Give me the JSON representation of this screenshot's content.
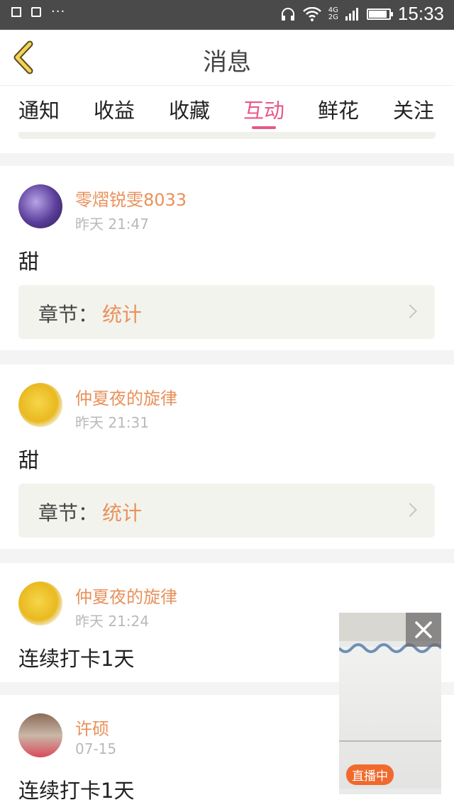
{
  "status_bar": {
    "time": "15:33",
    "network_top": "4G",
    "network_bottom": "2G",
    "battery_level": 0.9
  },
  "header": {
    "title": "消息"
  },
  "tabs": [
    {
      "label": "通知",
      "active": false
    },
    {
      "label": "收益",
      "active": false
    },
    {
      "label": "收藏",
      "active": false
    },
    {
      "label": "互动",
      "active": true
    },
    {
      "label": "鲜花",
      "active": false
    },
    {
      "label": "关注",
      "active": false
    }
  ],
  "messages": [
    {
      "name": "零熠锐雯8033",
      "time": "昨天 21:47",
      "content": "甜",
      "chapter_label": "章节：",
      "chapter_value": "统计"
    },
    {
      "name": "仲夏夜的旋律",
      "time": "昨天 21:31",
      "content": "甜",
      "chapter_label": "章节：",
      "chapter_value": "统计"
    },
    {
      "name": "仲夏夜的旋律",
      "time": "昨天 21:24",
      "content": "连续打卡1天"
    },
    {
      "name": "许硕",
      "time": "07-15",
      "content": "连续打卡1天"
    }
  ],
  "live_window": {
    "badge": "直播中"
  },
  "colors": {
    "accent": "#e8578a",
    "name": "#e8915b",
    "status_bar": "#4a4a4a",
    "back_arrow": "#f2d25a"
  }
}
